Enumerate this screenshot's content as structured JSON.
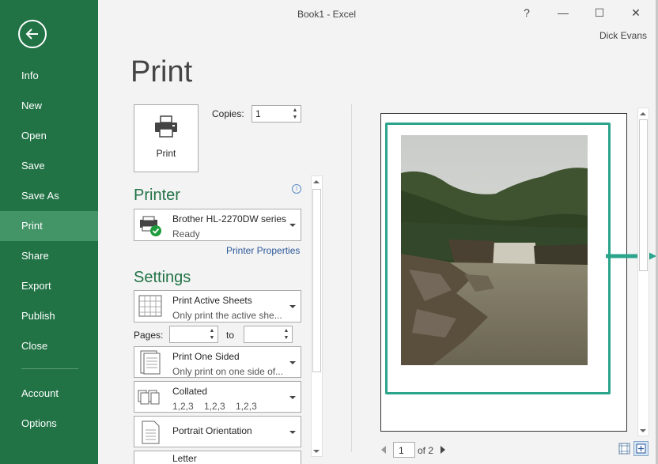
{
  "window": {
    "title": "Book1 - Excel",
    "user": "Dick Evans",
    "help": "?",
    "minimize": "—",
    "maximize": "☐",
    "close": "✕"
  },
  "nav": {
    "items": [
      "Info",
      "New",
      "Open",
      "Save",
      "Save As",
      "Print",
      "Share",
      "Export",
      "Publish",
      "Close"
    ],
    "footer": [
      "Account",
      "Options"
    ],
    "active": "Print"
  },
  "print": {
    "title": "Print",
    "button_label": "Print",
    "copies_label": "Copies:",
    "copies_value": "1"
  },
  "printer": {
    "heading": "Printer",
    "name": "Brother HL-2270DW series",
    "status": "Ready",
    "properties_link": "Printer Properties"
  },
  "settings": {
    "heading": "Settings",
    "what": {
      "main": "Print Active Sheets",
      "sub": "Only print the active she..."
    },
    "pages_label": "Pages:",
    "pages_to_label": "to",
    "sides": {
      "main": "Print One Sided",
      "sub": "Only print on one side of..."
    },
    "collation": {
      "main": "Collated",
      "sub": "1,2,3    1,2,3    1,2,3"
    },
    "orientation": {
      "main": "Portrait Orientation"
    },
    "paper": {
      "main": "Letter"
    }
  },
  "preview": {
    "page_number": "1",
    "page_of": "of 2",
    "highlight_color": "#2ba48c",
    "accent_color": "#217346"
  }
}
